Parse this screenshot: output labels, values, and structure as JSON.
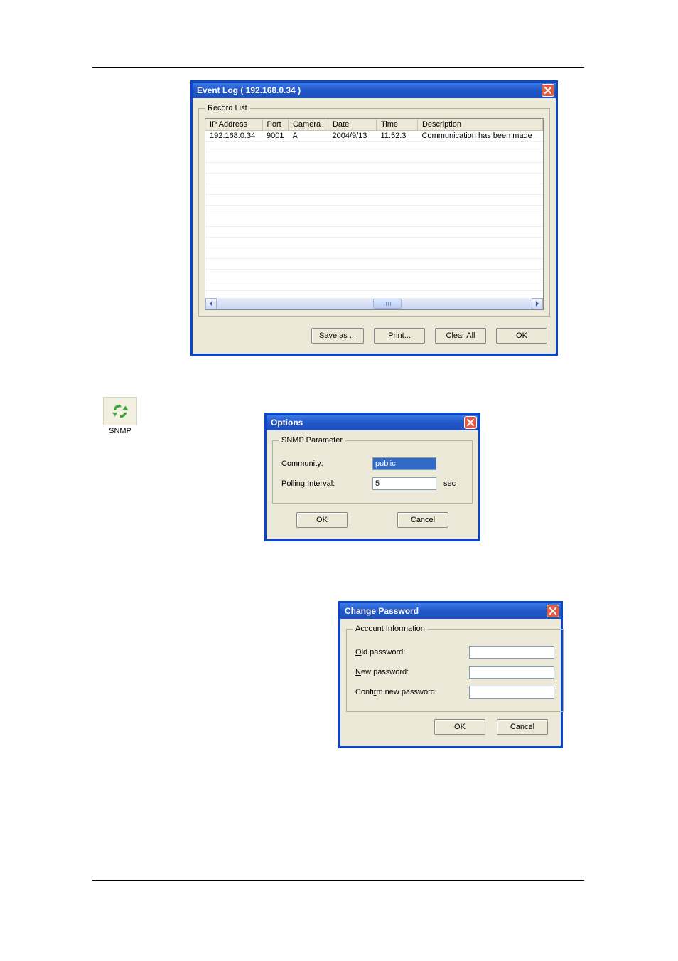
{
  "snmp_icon_label": "SNMP",
  "event_log": {
    "title": "Event Log ( 192.168.0.34 )",
    "group_legend": "Record List",
    "columns": {
      "ip": "IP Address",
      "port": "Port",
      "camera": "Camera",
      "date": "Date",
      "time": "Time",
      "description": "Description"
    },
    "rows": [
      {
        "ip": "192.168.0.34",
        "port": "9001",
        "camera": "A",
        "date": "2004/9/13",
        "time": "11:52:3",
        "description": "Communication has been made"
      }
    ],
    "buttons": {
      "save_as_prefix": "S",
      "save_as_suffix": "ave as ...",
      "print_prefix": "P",
      "print_suffix": "rint...",
      "clear_prefix": "C",
      "clear_suffix": "lear All",
      "ok": "OK"
    }
  },
  "options": {
    "title": "Options",
    "group_legend": "SNMP Parameter",
    "community_label": "Community:",
    "community_value": "public",
    "polling_label": "Polling Interval:",
    "polling_value": "5",
    "polling_unit": "sec",
    "ok": "OK",
    "cancel": "Cancel"
  },
  "change_password": {
    "title": "Change Password",
    "group_legend": "Account Information",
    "old_label_prefix": "O",
    "old_label_suffix": "ld password:",
    "new_label_prefix": "N",
    "new_label_suffix": "ew password:",
    "confirm_label_pre": "Confi",
    "confirm_label_u": "r",
    "confirm_label_post": "m new password:",
    "ok": "OK",
    "cancel": "Cancel"
  }
}
